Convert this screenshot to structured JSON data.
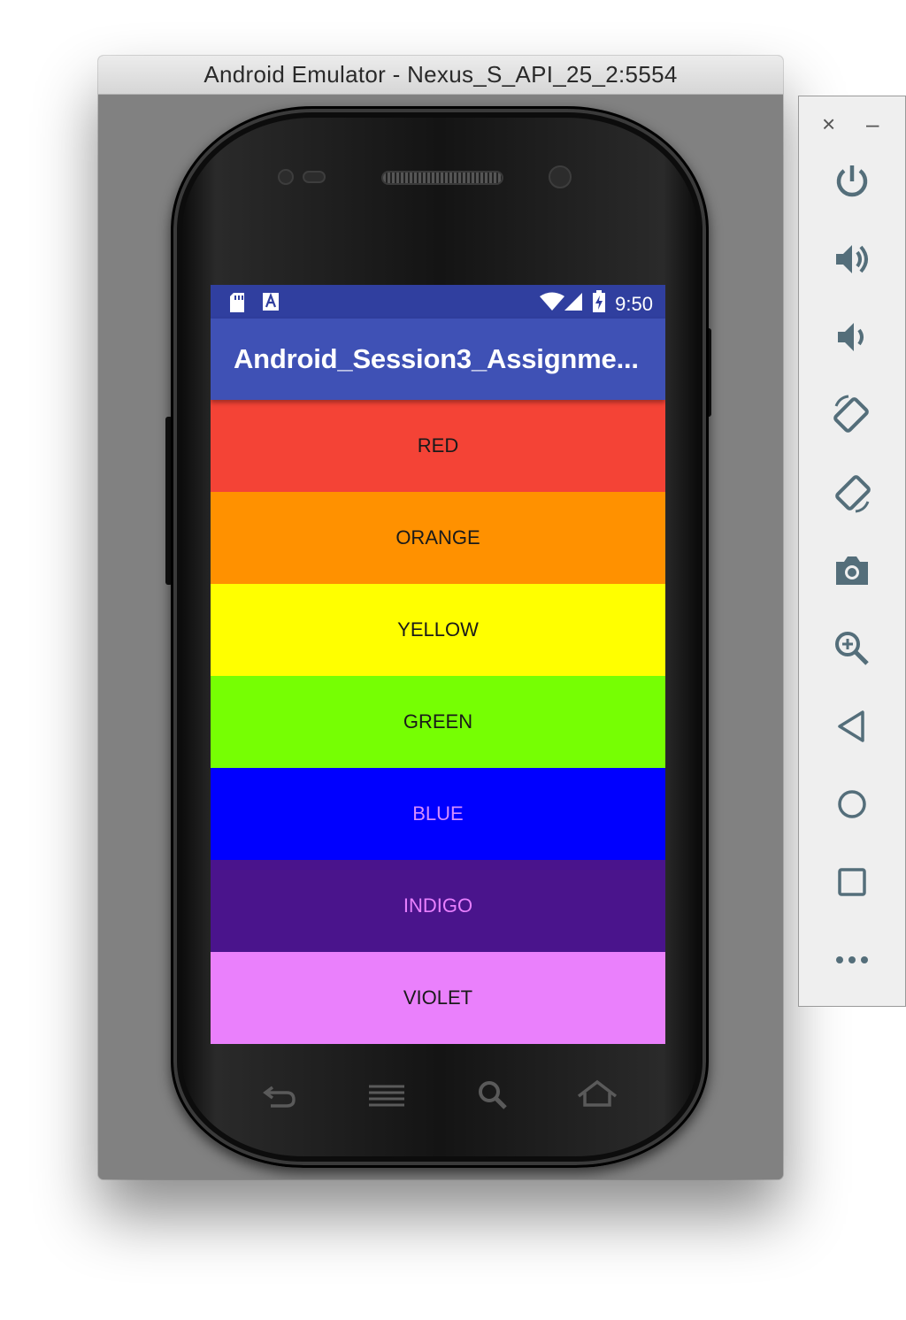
{
  "window": {
    "title": "Android Emulator - Nexus_S_API_25_2:5554"
  },
  "statusbar": {
    "time": "9:50",
    "icons": [
      "sd-card-icon",
      "keyboard-a-icon",
      "wifi-icon",
      "signal-icon",
      "battery-charging-icon"
    ]
  },
  "app": {
    "title": "Android_Session3_Assignme..."
  },
  "colors": [
    {
      "label": "RED",
      "bg": "#f44336",
      "fg": "#1a1a1a"
    },
    {
      "label": "ORANGE",
      "bg": "#ff9100",
      "fg": "#1a1a1a"
    },
    {
      "label": "YELLOW",
      "bg": "#ffff00",
      "fg": "#1a1a1a"
    },
    {
      "label": "GREEN",
      "bg": "#76ff03",
      "fg": "#1a1a1a"
    },
    {
      "label": "BLUE",
      "bg": "#0000ff",
      "fg": "#d58cff"
    },
    {
      "label": "INDIGO",
      "bg": "#4a148c",
      "fg": "#e880ff"
    },
    {
      "label": "VIOLET",
      "bg": "#ea80fc",
      "fg": "#1a1a1a"
    }
  ],
  "hardware_keys": [
    "back-key-icon",
    "menu-key-icon",
    "search-key-icon",
    "home-key-icon"
  ],
  "toolbar": {
    "close_label": "×",
    "minimize_label": "–",
    "buttons": [
      "power-icon",
      "volume-up-icon",
      "volume-down-icon",
      "rotate-left-icon",
      "rotate-right-icon",
      "camera-icon",
      "zoom-icon",
      "back-icon",
      "home-icon",
      "overview-icon",
      "more-icon"
    ],
    "icon_color": "#546e7a"
  }
}
